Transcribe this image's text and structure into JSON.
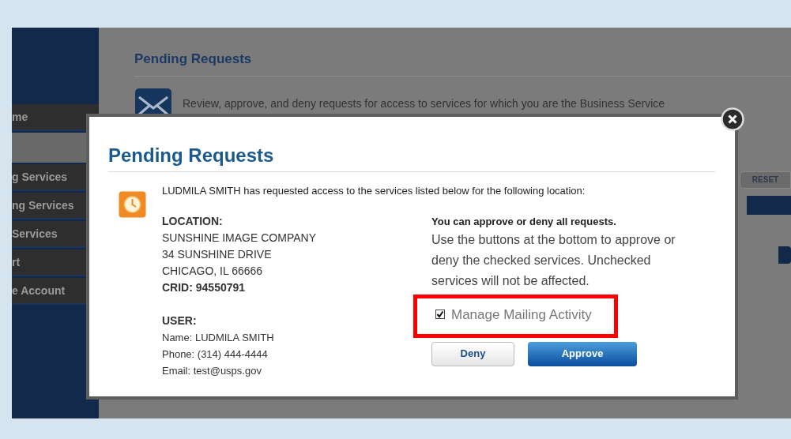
{
  "sidebar": {
    "items": [
      {
        "label": "me"
      },
      {
        "kind": "spacer"
      },
      {
        "label": "g Services"
      },
      {
        "label": "ng Services"
      },
      {
        "label": "Services"
      },
      {
        "label": "rt"
      },
      {
        "label": "e Account"
      }
    ]
  },
  "page": {
    "heading": "Pending Requests",
    "description": "Review, approve, and deny requests for access to services for which you are the Business Service",
    "reset_button": "RESET"
  },
  "dialog": {
    "title": "Pending Requests",
    "intro": "LUDMILA SMITH has requested access to the services listed below for the following location:",
    "location": {
      "heading": "LOCATION:",
      "lines": [
        "SUNSHINE IMAGE COMPANY",
        "34 SUNSHINE DRIVE",
        "CHICAGO, IL 66666"
      ],
      "crid": "CRID: 94550791"
    },
    "user": {
      "heading": "USER:",
      "lines": [
        "Name: LUDMILA SMITH",
        "Phone: (314) 444-4444",
        "Email: test@usps.gov"
      ]
    },
    "instructions": {
      "heading": "You can approve or deny all requests.",
      "text": "Use the buttons at the bottom to approve or deny the checked services. Unchecked services will not be affected."
    },
    "services": [
      {
        "label": "Manage Mailing Activity",
        "checked": true,
        "highlighted": true
      }
    ],
    "buttons": [
      {
        "label": "Deny",
        "kind": "secondary"
      },
      {
        "label": "Approve",
        "kind": "primary"
      }
    ]
  }
}
